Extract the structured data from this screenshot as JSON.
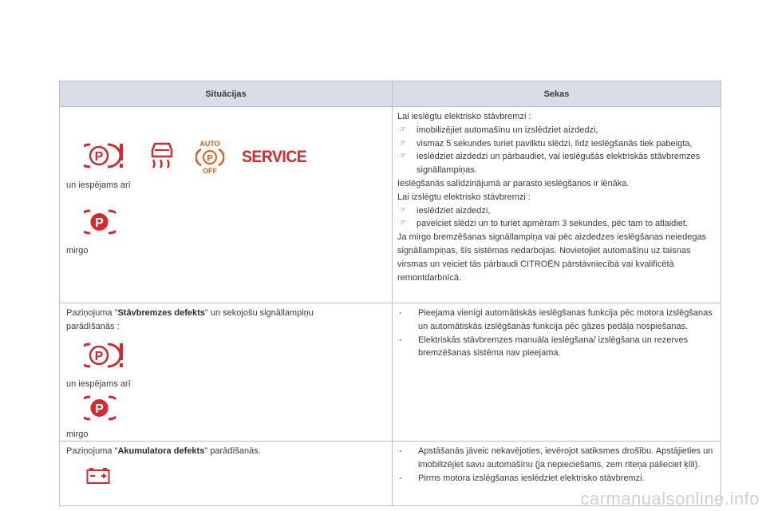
{
  "table": {
    "headers": [
      "Situācijas",
      "Sekas"
    ],
    "row1": {
      "left": {
        "also_possible": "un iespējams arī",
        "blinks": "mirgo",
        "service_label": "SERVICE",
        "auto_label": "AUTO",
        "off_label": "OFF"
      },
      "right": {
        "intro": "Lai ieslēgtu elektrisko stāvbremzi :",
        "bullets1": [
          "imobilizējiet automašīnu un izslēdziet aizdedzi,",
          "vismaz 5 sekundes turiet pavilktu slēdzi, līdz ieslēgšanās tiek pabeigta,",
          "ieslēdziet aizdedzi un pārbaudiet, vai ieslēgušās elektriskās stāvbremzes signāllampiņas."
        ],
        "note1": "Ieslēgšanās salīdzinājumā ar parasto ieslēgšanos ir lēnāka.",
        "intro2": "Lai izslēgtu elektrisko stāvbremzi :",
        "bullets2": [
          "ieslēdziet aizdedzi,",
          "pavelciet slēdzi un to turiet apmēram 3 sekundes, pēc tam to atlaidiet."
        ],
        "closing": "Ja mirgo bremzēšanas signāllampiņa vai pēc aizdedzes ieslēgšanas neiedegas signāllampiņas, šīs sistēmas nedarbojas. Novietojiet automašīnu uz taisnas virsmas un veiciet tās pārbaudi CITROËN pārstāvniecībā vai kvalificētā remontdarbnīcā."
      }
    },
    "row2": {
      "left": {
        "prefix": "Paziņojuma \"",
        "bold": "Stāvbremzes defekts",
        "suffix": "\" un sekojošu signāllampiņu parādīšanās :",
        "also_possible": "un iespējams arī",
        "blinks": "mirgo"
      },
      "right": {
        "dashes": [
          "Pieejama vienīgi automātiskās ieslēgšanas funkcija pēc motora izslēgšanas un automātiskās izslēgšanās funkcija pēc gāzes pedāļa nospiešanas.",
          "Elektriskās stāvbremzes manuāla ieslēgšana/ izslēgšana un rezerves bremzēšanas sistēma nav pieejama."
        ]
      }
    },
    "row3": {
      "left": {
        "prefix": "Paziņojuma \"",
        "bold": "Akumulatora defekts",
        "suffix": "\" parādīšanās."
      },
      "right": {
        "dashes": [
          "Apstāšanās jāveic nekavējoties, ievērojot satiksmes drošību. Apstājieties un imobilizējiet savu automašīnu (ja nepieciešams, zem riteņa palieciet ķīli).",
          "Pirms motora izslēgšanas ieslēdziet elektrisko stāvbremzi."
        ]
      }
    }
  },
  "colors": {
    "warning_red": "#d6282f",
    "header_bg": "#d9dde6",
    "border": "#b9bfcd",
    "auto_orange": "#e05a1e"
  },
  "watermark": "carmanualsonline.info"
}
